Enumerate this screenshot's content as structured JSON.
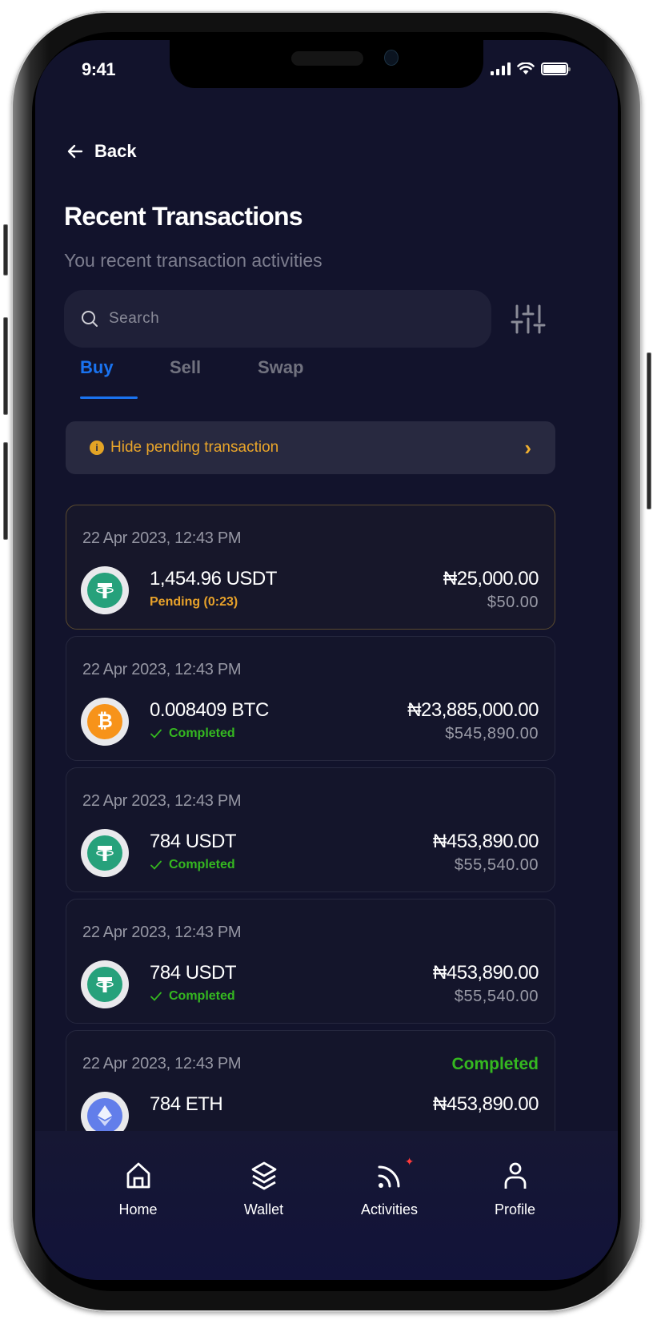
{
  "status_bar": {
    "time": "9:41"
  },
  "header": {
    "back_label": "Back",
    "title": "Recent Transactions",
    "subtitle": "You recent transaction activities"
  },
  "search": {
    "placeholder": "Search",
    "value": ""
  },
  "tabs": [
    {
      "label": "Buy",
      "active": true
    },
    {
      "label": "Sell",
      "active": false
    },
    {
      "label": "Swap",
      "active": false
    }
  ],
  "pending_banner": {
    "label": "Hide pending transaction",
    "icon": "info-icon"
  },
  "transactions": [
    {
      "date": "22 Apr 2023, 12:43 PM",
      "coin": "USDT",
      "coin_icon": "tether-icon",
      "coin_color": "#26a17b",
      "amount": "1,454.96 USDT",
      "status": "Pending (0:23)",
      "status_type": "pending",
      "naira": "₦25,000.00",
      "usd": "$50.00"
    },
    {
      "date": "22 Apr 2023, 12:43 PM",
      "coin": "BTC",
      "coin_icon": "bitcoin-icon",
      "coin_color": "#f7931a",
      "amount": "0.008409 BTC",
      "status": "Completed",
      "status_type": "completed",
      "naira": "₦23,885,000.00",
      "usd": "$545,890.00"
    },
    {
      "date": "22 Apr 2023, 12:43 PM",
      "coin": "USDT",
      "coin_icon": "tether-icon",
      "coin_color": "#26a17b",
      "amount": "784 USDT",
      "status": "Completed",
      "status_type": "completed",
      "naira": "₦453,890.00",
      "usd": "$55,540.00"
    },
    {
      "date": "22 Apr 2023, 12:43 PM",
      "coin": "USDT",
      "coin_icon": "tether-icon",
      "coin_color": "#26a17b",
      "amount": "784 USDT",
      "status": "Completed",
      "status_type": "completed",
      "naira": "₦453,890.00",
      "usd": "$55,540.00"
    },
    {
      "date": "22 Apr 2023, 12:43 PM",
      "coin": "ETH",
      "coin_icon": "ethereum-icon",
      "coin_color": "#627eea",
      "amount": "784 ETH",
      "status": "Completed",
      "status_type": "completed",
      "naira": "₦453,890.00",
      "usd": ""
    }
  ],
  "bottom_nav": [
    {
      "label": "Home",
      "icon": "home-icon"
    },
    {
      "label": "Wallet",
      "icon": "layers-icon"
    },
    {
      "label": "Activities",
      "icon": "activity-feed-icon",
      "badge": "✦"
    },
    {
      "label": "Profile",
      "icon": "user-icon"
    }
  ],
  "colors": {
    "background": "#12132c",
    "accent": "#1a73f0",
    "pending": "#e8a22a",
    "completed": "#35b820",
    "alert_badge": "#ff3a3a"
  }
}
